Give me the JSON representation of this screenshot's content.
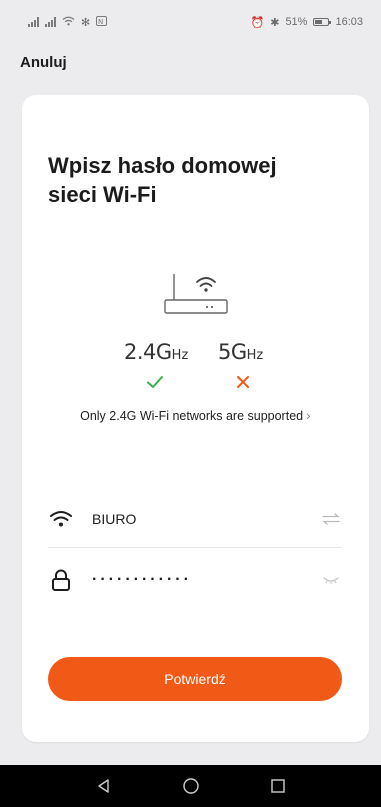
{
  "status_bar": {
    "battery_percent": "51%",
    "time": "16:03",
    "icons": [
      "signal-icon",
      "signal-icon",
      "wifi-icon",
      "nfc-icon",
      "alarm-icon",
      "bluetooth-icon",
      "battery-icon"
    ]
  },
  "header": {
    "cancel_label": "Anuluj"
  },
  "card": {
    "title": "Wpisz hasło domowej sieci Wi-Fi",
    "router_icon": "router-icon",
    "bands": {
      "band_24": {
        "label": "2.4G",
        "unit": "Hz",
        "supported": true
      },
      "band_5": {
        "label": "5G",
        "unit": "Hz",
        "supported": false
      }
    },
    "support_note": "Only 2.4G Wi-Fi networks are supported",
    "ssid_field": {
      "value": "BIURO",
      "icon": "wifi-icon",
      "action_icon": "switch-network-icon"
    },
    "password_field": {
      "value": "············",
      "icon": "lock-icon",
      "action_icon": "eye-hidden-icon"
    },
    "confirm_label": "Potwierdź"
  },
  "colors": {
    "accent": "#f05a16",
    "ok": "#3ab04a",
    "fail": "#f05a16",
    "background": "#ececee",
    "card": "#ffffff"
  },
  "nav_bar": {
    "icons": [
      "back-icon",
      "home-icon",
      "recents-icon"
    ]
  }
}
